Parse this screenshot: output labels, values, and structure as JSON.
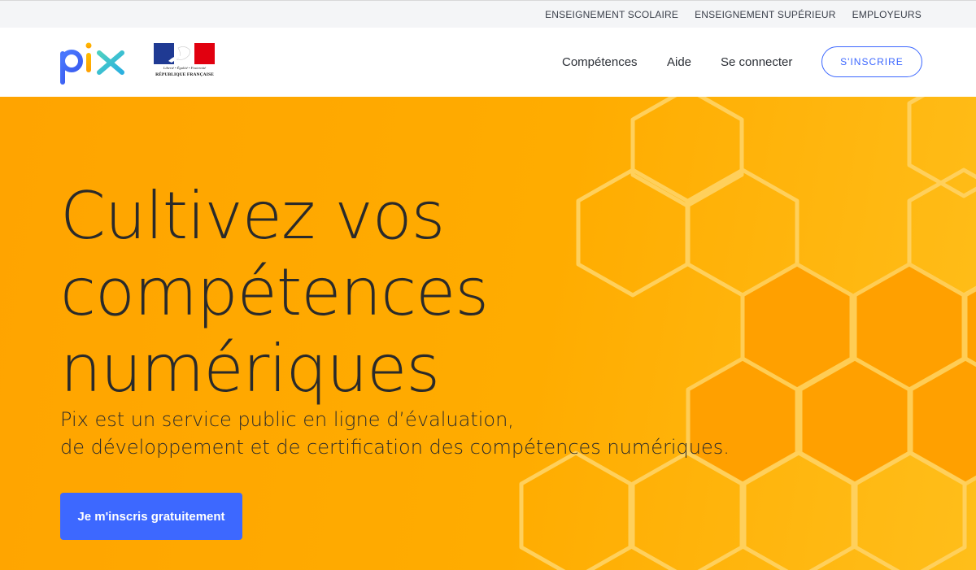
{
  "topbar": {
    "links": [
      "ENSEIGNEMENT SCOLAIRE",
      "ENSEIGNEMENT SUPÉRIEUR",
      "EMPLOYEURS"
    ]
  },
  "header": {
    "logo_text": "pix",
    "republique_motto": "Liberté • Égalité • Fraternité",
    "republique_name": "RÉPUBLIQUE FRANÇAISE",
    "nav": [
      "Compétences",
      "Aide",
      "Se connecter"
    ],
    "signup_label": "S'INSCRIRE"
  },
  "hero": {
    "title_lines": [
      "Cultivez vos",
      "compétences",
      "numériques"
    ],
    "subtitle_lines": [
      "Pix est un service public en ligne d’évaluation,",
      "de développement et de certification des compétences numériques."
    ],
    "cta_label": "Je m'inscris gratuitement"
  },
  "colors": {
    "accent": "#3d68ff",
    "hero_orange": "#ffa400",
    "hex_fill": "#ffa200",
    "hex_stroke": "#ffd263"
  },
  "icons": {
    "logo": "pix-logo",
    "republique": "marianne-logo"
  }
}
